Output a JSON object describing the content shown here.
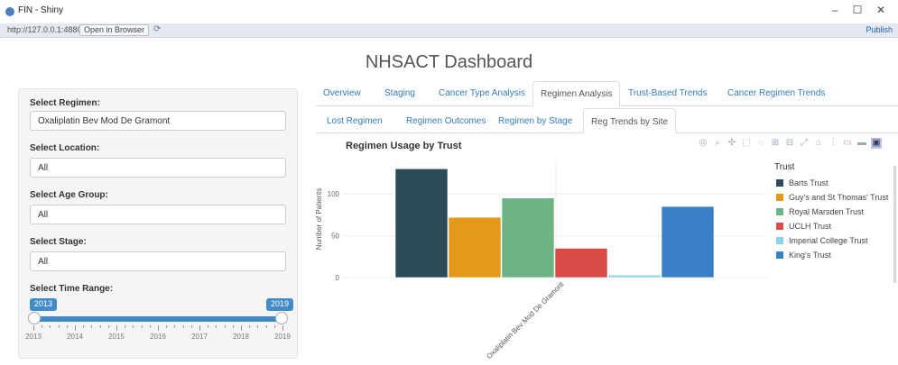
{
  "window": {
    "title": "FIN - Shiny",
    "min_glyph": "–",
    "max_glyph": "☐",
    "close_glyph": "✕"
  },
  "addressbar": {
    "url": "http://127.0.0.1:4880",
    "open_in_browser": "Open in Browser",
    "refresh_icon": "refresh-icon",
    "publish": "Publish"
  },
  "page": {
    "title": "NHSACT Dashboard"
  },
  "sidebar": {
    "fields": [
      {
        "label": "Select Regimen:",
        "value": "Oxaliplatin Bev Mod De Gramont"
      },
      {
        "label": "Select Location:",
        "value": "All"
      },
      {
        "label": "Select Age Group:",
        "value": "All"
      },
      {
        "label": "Select Stage:",
        "value": "All"
      }
    ],
    "slider": {
      "label": "Select Time Range:",
      "min_value": "2013",
      "max_value": "2019",
      "grid": [
        "2013",
        "2014",
        "2015",
        "2016",
        "2017",
        "2018",
        "2019"
      ]
    }
  },
  "tabs": {
    "main": [
      "Overview",
      "Staging",
      "Cancer Type Analysis",
      "Regimen Analysis",
      "Trust-Based Trends",
      "Cancer Regimen Trends"
    ],
    "main_active": 3,
    "sub": [
      "Lost Regimen",
      "Regimen Outcomes",
      "Regimen by Stage",
      "Reg Trends by Site"
    ],
    "sub_active": 3
  },
  "chart_data": {
    "type": "bar",
    "title": "Regimen Usage by Trust",
    "xlabel": "",
    "ylabel": "Number of Patients",
    "categories": [
      "Oxaliplatin Bev Mod De Gramont"
    ],
    "ylim": [
      0,
      140
    ],
    "yticks": [
      "0",
      "50",
      "100"
    ],
    "legend_title": "Trust",
    "legend_position": "right",
    "grid": true,
    "series": [
      {
        "name": "Barts Trust",
        "value": 130,
        "color": "#2c4a5a"
      },
      {
        "name": "Guy's and St Thomas' Trust",
        "value": 72,
        "color": "#e49a18"
      },
      {
        "name": "Royal Marsden Trust",
        "value": 95,
        "color": "#6db383"
      },
      {
        "name": "UCLH Trust",
        "value": 35,
        "color": "#d94b48"
      },
      {
        "name": "Imperial College Trust",
        "value": 3,
        "color": "#8fd3ea"
      },
      {
        "name": "King's Trust",
        "value": 85,
        "color": "#3a80c7"
      }
    ]
  },
  "modebar": {
    "icons": [
      "camera-icon",
      "zoom-icon",
      "pan-icon",
      "box-select-icon",
      "lasso-icon",
      "zoom-in-icon",
      "zoom-out-icon",
      "autoscale-icon",
      "reset-axes-icon",
      "spike-lines-icon",
      "hover-closest-icon",
      "hover-compare-icon",
      "plotly-logo-icon"
    ],
    "glyphs": [
      "◎",
      "⌕",
      "✣",
      "⬚",
      "◌",
      "⊞",
      "⊟",
      "⤢",
      "⌂",
      "⫶",
      "▭",
      "▬",
      "▣"
    ]
  }
}
